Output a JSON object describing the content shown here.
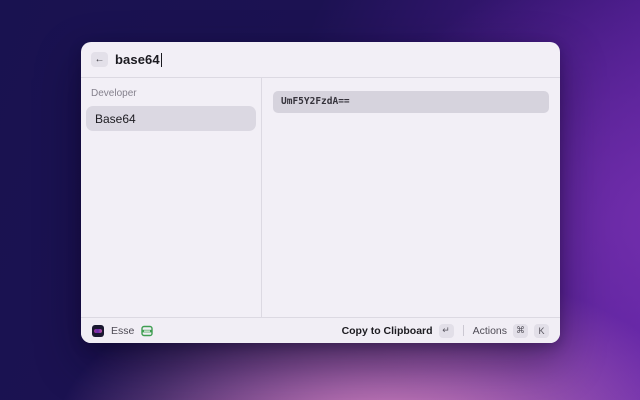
{
  "window": {
    "search_bar": {
      "back_icon": "←",
      "query": "base64"
    },
    "sidebar": {
      "section_label": "Developer",
      "items": [
        {
          "label": "Base64",
          "selected": true
        }
      ]
    },
    "detail": {
      "encoded_value": "UmF5Y2FzdA=="
    },
    "footer": {
      "app_name": "Esse",
      "primary_action_label": "Copy to Clipboard",
      "primary_action_key": "↵",
      "secondary_action_label": "Actions",
      "secondary_action_keys": [
        "⌘",
        "K"
      ]
    }
  },
  "colors": {
    "window_background": "#f2eff6",
    "selected_item_background": "#dbd8e2",
    "code_block_background": "#d6d3dd",
    "status_icon_green": "#3f9e52",
    "wallpaper_dark_indigo": "#191250",
    "wallpaper_purple": "#5c21a4",
    "wallpaper_pink_glow": "#e792ca"
  }
}
